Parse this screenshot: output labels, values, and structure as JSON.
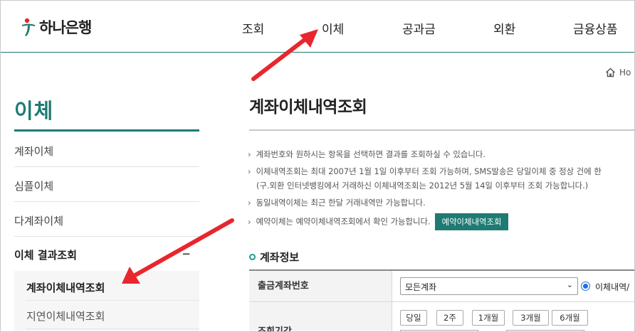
{
  "header": {
    "logo_text": "하나은행",
    "nav": [
      "조회",
      "이체",
      "공과금",
      "외환",
      "금융상품"
    ]
  },
  "breadcrumb": {
    "home_label": "Ho"
  },
  "lnb": {
    "title": "이체",
    "items": [
      "계좌이체",
      "심플이체",
      "다계좌이체",
      "이체 결과조회"
    ],
    "expand_icon": "−",
    "sub_items": [
      "계좌이체내역조회",
      "지연이체내역조회"
    ]
  },
  "content": {
    "page_title": "계좌이체내역조회",
    "note_marker": "›",
    "notes": [
      "계좌번호와 원하시는 항목을 선택하면 결과를 조회하실 수 있습니다.",
      "이체내역조회는 최대 2007년 1월 1일 이후부터 조회 가능하며, SMS발송은 당일이체 중 정상 건에 한",
      "(구.외환 인터넷뱅킹에서 거래하신 이체내역조회는 2012년 5월 14일 이후부터 조회 가능합니다.)",
      "동일내역이체는 최근 한달 거래내역만 가능합니다.",
      "예약이체는 예약이체내역조회에서 확인 가능합니다."
    ],
    "reserve_button": "예약이체내역조회",
    "section_title": "계좌정보",
    "form": {
      "account_label": "출금계좌번호",
      "account_value": "모든계좌",
      "radio_label": "이체내역/",
      "period_label": "조회기간",
      "period_buttons": [
        "당일",
        "2주",
        "1개월",
        "3개월",
        "6개월"
      ]
    }
  },
  "colors": {
    "brand": "#1e7b73",
    "annotation_arrow": "#e8262e"
  }
}
